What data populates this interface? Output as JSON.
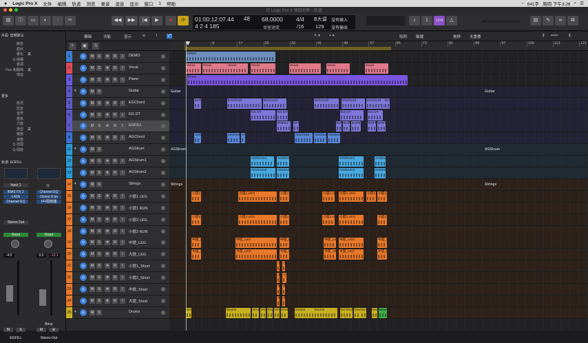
{
  "menubar": {
    "apple": "",
    "app": "Logic Pro X",
    "items": [
      "文件",
      "编辑",
      "轨道",
      "测览",
      "录音",
      "混音",
      "显示",
      "窗口",
      "1",
      "帮助"
    ],
    "status": "641字",
    "clock": "周四 下午3:26"
  },
  "window": {
    "title": "日 Logic Pro X 项目名称 - 轨道"
  },
  "lcd": {
    "time": "01:00:12:07.44",
    "bars": "4  2  4  185",
    "sub": "48",
    "tempo": "68.0000",
    "tempo_label": "保留速度",
    "sig": "4/4",
    "sig_div": "/16",
    "key": "B大调",
    "key_num": "129",
    "in": "没有输入",
    "out": "没有输出"
  },
  "toolbar": {
    "edit": "编辑",
    "func": "功能",
    "view": "显示",
    "snap_label": "吸附:",
    "snap": "敏捷",
    "drag_label": "拖移:",
    "drag": "无重叠"
  },
  "inspector": {
    "region_title": "片段: 音频默认",
    "rows": [
      [
        "静音",
        ""
      ],
      [
        "循环",
        ""
      ],
      [
        "量化",
        "关"
      ],
      [
        "Q-摇摆",
        ""
      ],
      [
        "移调",
        ""
      ],
      [
        "Flex 和跟随",
        "关"
      ],
      [
        "增益",
        ""
      ]
    ],
    "more": "更多",
    "more_rows": [
      [
        "延迟",
        ""
      ],
      [
        "琶音",
        ""
      ],
      [
        "音符",
        ""
      ],
      [
        "重复",
        ""
      ],
      [
        "力度",
        ""
      ],
      [
        "类型",
        "关"
      ],
      [
        "键盘",
        ""
      ],
      [
        "速度",
        ""
      ],
      [
        "Q-范围",
        ""
      ],
      [
        "Q-强度",
        ""
      ]
    ],
    "track_label": "轨道: EGFILL",
    "strip_left": {
      "input": "Input 1",
      "plugins": [
        "BIAS FX 2",
        "LA2A",
        "Channel EQ"
      ],
      "out": "Stereo Out",
      "auto": "Read",
      "vol": "-4.0",
      "name": "EGFILL"
    },
    "strip_right": {
      "plugins": [
        "Channel EQ",
        "Ozone 8 Im",
        "FF/限制器"
      ],
      "auto": "Read",
      "vol": "0.0",
      "peak": "-12.1",
      "extra": "Brice",
      "name": "Stereo Out"
    }
  },
  "tracks": [
    {
      "n": "1",
      "name": "DEMO",
      "color": "#3a7ed0"
    },
    {
      "n": "2",
      "name": "Vocal",
      "color": "#e04b5a"
    },
    {
      "n": "3",
      "name": "Piano",
      "color": "#6a5adf"
    },
    {
      "n": "4",
      "name": "Guitar",
      "color": "#5e58c4",
      "folder": true
    },
    {
      "n": "5",
      "name": "EGChord",
      "color": "#5e58c4"
    },
    {
      "n": "6",
      "name": "EG DT",
      "color": "#5e58c4"
    },
    {
      "n": "7",
      "name": "EGFILL",
      "color": "#5e58c4",
      "sel": true
    },
    {
      "n": "8",
      "name": "AGChord",
      "color": "#3b6fd6"
    },
    {
      "n": "11",
      "name": "AGStrum",
      "color": "#2a9bd6",
      "folder": true
    },
    {
      "n": "12",
      "name": "AGStrum1",
      "color": "#2a9bd6"
    },
    {
      "n": "13",
      "name": "AGStrum2",
      "color": "#2a9bd6"
    },
    {
      "n": "14",
      "name": "Strings",
      "color": "#e8782a",
      "folder": true
    },
    {
      "n": "15",
      "name": "小提1 LEG",
      "color": "#e8782a"
    },
    {
      "n": "16",
      "name": "小提1 RUN",
      "color": "#e8782a"
    },
    {
      "n": "17",
      "name": "小提2 LEG",
      "color": "#e8782a"
    },
    {
      "n": "18",
      "name": "小提2 RUN",
      "color": "#e8782a"
    },
    {
      "n": "19",
      "name": "中提_LEG",
      "color": "#e8782a"
    },
    {
      "n": "20",
      "name": "大提_LEG",
      "color": "#e8782a"
    },
    {
      "n": "21",
      "name": "小提1_Short",
      "color": "#e8782a"
    },
    {
      "n": "22",
      "name": "小提2_Short",
      "color": "#e8782a"
    },
    {
      "n": "23",
      "name": "中提_Short",
      "color": "#e8782a"
    },
    {
      "n": "24",
      "name": "大提_Short",
      "color": "#e8782a"
    },
    {
      "n": "25",
      "name": "Drums",
      "color": "#c8b020",
      "folder": true
    }
  ],
  "ruler": [
    "1",
    "9",
    "17",
    "25",
    "33",
    "41",
    "49",
    "57",
    "65",
    "73",
    "81",
    "89",
    "97",
    "105",
    "113",
    "121"
  ],
  "folder_labels": {
    "guitar": "Guitar",
    "agstrum": "AGStrum",
    "strings": "Strings"
  }
}
